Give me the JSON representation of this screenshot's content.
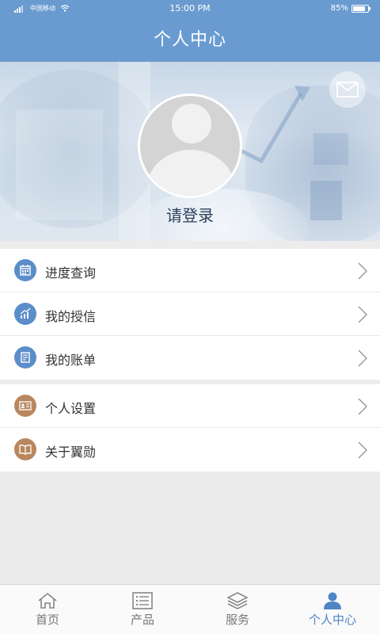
{
  "status_bar": {
    "carrier": "中国移动",
    "time": "15:00 PM",
    "battery": "85%",
    "battery_level": 0.85
  },
  "header": {
    "title": "个人中心"
  },
  "profile": {
    "login_prompt": "请登录"
  },
  "menu_group_1": [
    {
      "label": "进度查询",
      "icon": "calendar-icon"
    },
    {
      "label": "我的授信",
      "icon": "chart-up-icon"
    },
    {
      "label": "我的账单",
      "icon": "bill-icon"
    }
  ],
  "menu_group_2": [
    {
      "label": "个人设置",
      "icon": "id-card-icon"
    },
    {
      "label": "关于翼勋",
      "icon": "book-icon"
    }
  ],
  "tabs": [
    {
      "label": "首页",
      "icon": "home-icon",
      "active": false
    },
    {
      "label": "产品",
      "icon": "list-icon",
      "active": false
    },
    {
      "label": "服务",
      "icon": "layers-icon",
      "active": false
    },
    {
      "label": "个人中心",
      "icon": "person-icon",
      "active": true
    }
  ],
  "colors": {
    "header": "#6a9bd0",
    "active_tab": "#4f86c5",
    "icon_blue": "#5b8ec9",
    "icon_tan": "#b9875f"
  }
}
